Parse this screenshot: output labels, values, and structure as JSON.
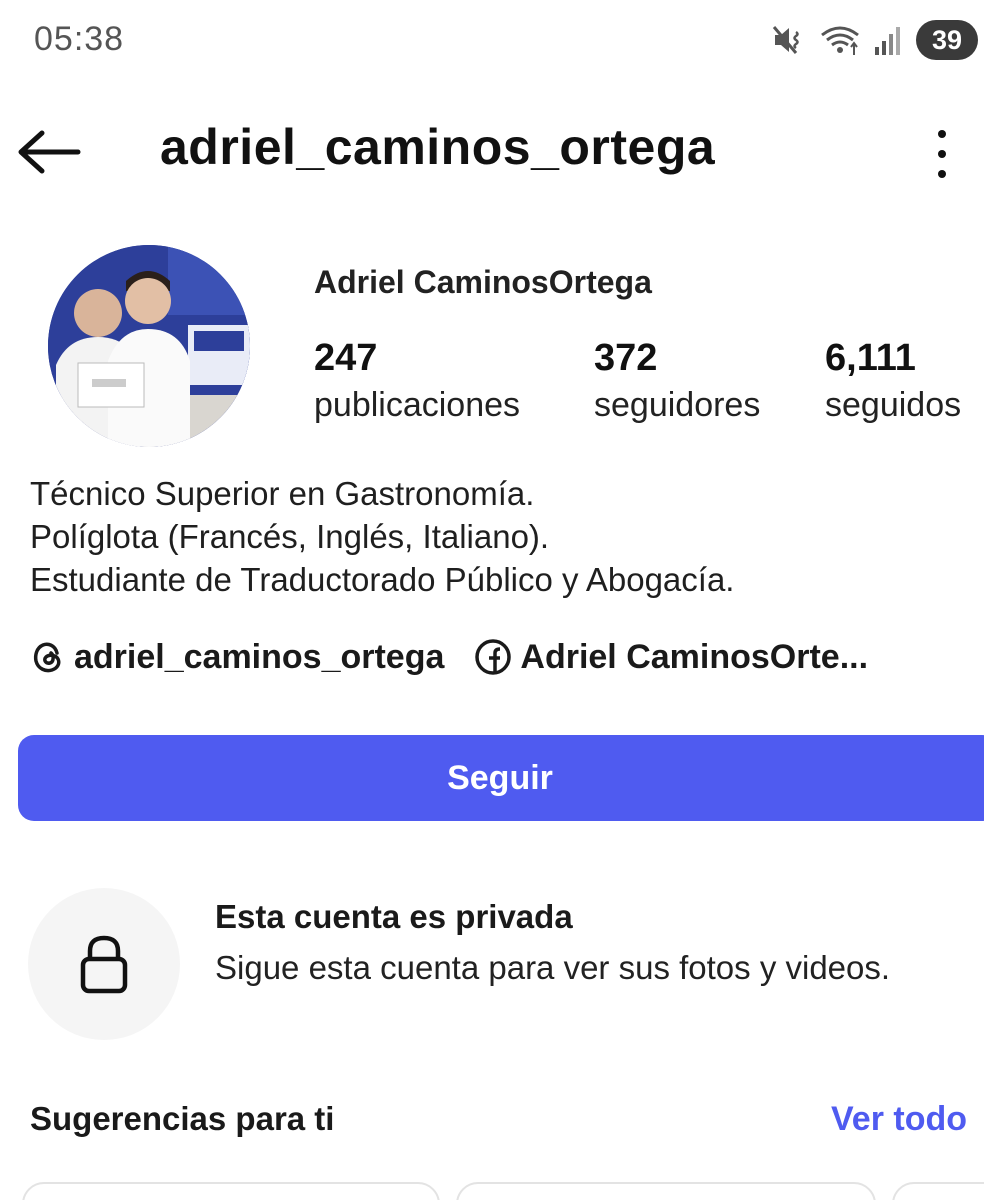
{
  "status_bar": {
    "time": "05:38",
    "battery": "39",
    "icons": [
      "muted-vibrate-icon",
      "wifi-icon",
      "signal-icon",
      "battery-icon"
    ]
  },
  "header": {
    "username": "adriel_caminos_ortega",
    "back_icon": "back-arrow-icon",
    "more_icon": "more-vertical-icon"
  },
  "profile": {
    "display_name": "Adriel CaminosOrtega",
    "avatar_icon": "profile-photo",
    "stats": [
      {
        "value": "247",
        "label": "publicaciones"
      },
      {
        "value": "372",
        "label": "seguidores"
      },
      {
        "value": "6,111",
        "label": "seguidos"
      }
    ],
    "bio": [
      "Técnico Superior en Gastronomía.",
      "Políglota (Francés, Inglés, Italiano).",
      "Estudiante de Traductorado Público y Abogacía."
    ],
    "links": [
      {
        "icon": "threads-icon",
        "text": "adriel_caminos_ortega"
      },
      {
        "icon": "facebook-icon",
        "text": "Adriel CaminosOrte..."
      }
    ]
  },
  "actions": {
    "follow_label": "Seguir"
  },
  "private_notice": {
    "icon": "lock-icon",
    "title": "Esta cuenta es privada",
    "text": "Sigue esta cuenta para ver sus fotos y videos."
  },
  "suggestions": {
    "title": "Sugerencias para ti",
    "see_all": "Ver todo"
  },
  "colors": {
    "accent": "#4f5bf0",
    "text": "#1a1a1a",
    "lock_bg": "#f5f5f5"
  }
}
